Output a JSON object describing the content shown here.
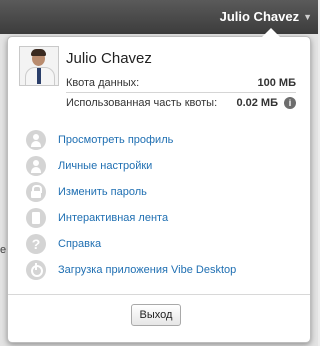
{
  "topbar": {
    "user_name": "Julio Chavez"
  },
  "background": {
    "side_mark": "е"
  },
  "profile": {
    "name": "Julio Chavez",
    "quota_label": "Квота данных:",
    "quota_value": "100 МБ",
    "used_label": "Использованная часть квоты:",
    "used_value": "0.02 МБ",
    "info_glyph": "i"
  },
  "menu": {
    "items": [
      {
        "label": "Просмотреть профиль",
        "icon": "person-icon"
      },
      {
        "label": "Личные настройки",
        "icon": "person-settings-icon"
      },
      {
        "label": "Изменить пароль",
        "icon": "lock-icon"
      },
      {
        "label": "Интерактивная лента",
        "icon": "feed-icon"
      },
      {
        "label": "Справка",
        "icon": "help-icon"
      },
      {
        "label": "Загрузка приложения Vibe Desktop",
        "icon": "power-icon"
      }
    ]
  },
  "footer": {
    "logout_label": "Выход"
  }
}
